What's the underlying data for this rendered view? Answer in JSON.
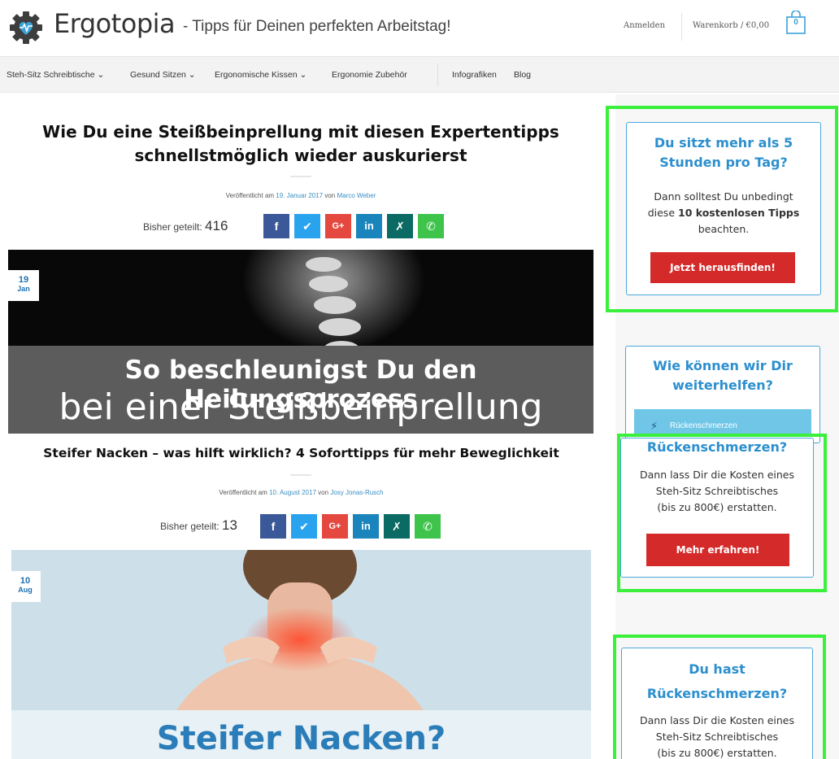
{
  "header": {
    "logo_text": "Ergotopia",
    "tagline": "- Tipps für Deinen perfekten Arbeitstag!",
    "login_label": "Anmelden",
    "cart_label": "Warenkorb / €0,00",
    "cart_count": "0"
  },
  "nav": {
    "items": [
      "Steh-Sitz Schreibtische ⌄",
      "Gesund Sitzen ⌄",
      "Ergonomische Kissen ⌄",
      "Ergonomie Zubehör",
      "Infografiken",
      "Blog"
    ]
  },
  "posts": [
    {
      "title_line1": "Wie Du eine Steißbeinprellung mit diesen Expertentipps",
      "title_line2": "schnellstmöglich wieder auskurierst",
      "meta_prefix": "Veröffentlicht am",
      "date": "19. Januar 2017",
      "meta_by": "von",
      "author": "Marco Weber",
      "shared_label": "Bisher geteilt:",
      "shared_count": "416",
      "badge_day": "19",
      "badge_month": "Jan",
      "image_line1": "So beschleunigst Du den Heilungsprozess",
      "image_line2": "bei einer Steißbeinprellung"
    },
    {
      "title": "Steifer Nacken – was hilft wirklich? 4 Soforttipps für mehr Beweglichkeit",
      "meta_prefix": "Veröffentlicht am",
      "date": "10. August 2017",
      "meta_by": "von",
      "author": "Josy Jonas-Rusch",
      "shared_label": "Bisher geteilt:",
      "shared_count": "13",
      "badge_day": "10",
      "badge_month": "Aug",
      "image_text": "Steifer Nacken?"
    }
  ],
  "share_icons": {
    "facebook": "f",
    "twitter": "🐦",
    "googleplus": "G+",
    "linkedin": "in",
    "xing": "✗",
    "whatsapp": "✆"
  },
  "sidebar": {
    "widget1": {
      "title_line1": "Du sitzt mehr als 5",
      "title_line2": "Stunden pro Tag?",
      "text_line1": "Dann solltest Du unbedingt",
      "text_pre": "diese",
      "text_bold": "10 kostenlosen Tipps",
      "text_line3": "beachten.",
      "button": "Jetzt herausfinden!"
    },
    "widget2": {
      "title_line1": "Wie können wir Dir",
      "title_line2": "weiterhelfen?",
      "dropdown_label": "Rückenschmerzen"
    },
    "widget3": {
      "title": "Rückenschmerzen?",
      "text_line1": "Dann lass Dir die Kosten eines",
      "text_line2": "Steh-Sitz Schreibtisches",
      "text_line3": "(bis zu 800€) erstatten.",
      "button": "Mehr erfahren!"
    },
    "widget4": {
      "title_line1": "Du hast",
      "title_line2": "Rückenschmerzen?",
      "text_line1": "Dann lass Dir die Kosten eines",
      "text_line2": "Steh-Sitz Schreibtisches",
      "text_line3": "(bis zu 800€) erstatten."
    }
  },
  "colors": {
    "accent_blue": "#2c8fce",
    "cta_red": "#d42a2a",
    "highlight_green": "#3af03a"
  }
}
